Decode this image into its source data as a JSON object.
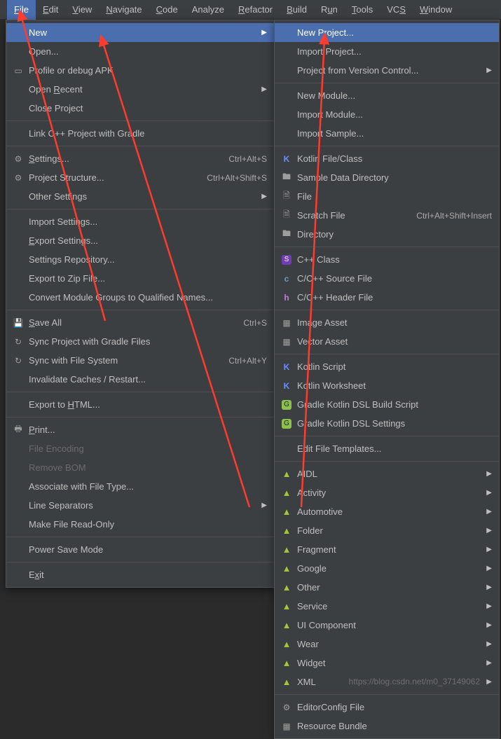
{
  "menubar": {
    "items": [
      {
        "label": "File",
        "mnemonic": "F",
        "active": true
      },
      {
        "label": "Edit",
        "mnemonic": "E"
      },
      {
        "label": "View",
        "mnemonic": "V"
      },
      {
        "label": "Navigate",
        "mnemonic": "N"
      },
      {
        "label": "Code",
        "mnemonic": "C"
      },
      {
        "label": "Analyze"
      },
      {
        "label": "Refactor",
        "mnemonic": "R"
      },
      {
        "label": "Build",
        "mnemonic": "B"
      },
      {
        "label": "Run",
        "mnemonic": "u"
      },
      {
        "label": "Tools",
        "mnemonic": "T"
      },
      {
        "label": "VCS",
        "mnemonic": "S"
      },
      {
        "label": "Window",
        "mnemonic": "W"
      }
    ]
  },
  "fileMenu": {
    "groups": [
      [
        {
          "label": "New",
          "submenu": true,
          "highlight": true
        },
        {
          "label": "Open..."
        },
        {
          "label": "Profile or debug APK",
          "icon": "pkg"
        },
        {
          "label": "Open Recent",
          "submenu": true,
          "mnemonic": "R"
        },
        {
          "label": "Close Project"
        }
      ],
      [
        {
          "label": "Link C++ Project with Gradle"
        }
      ],
      [
        {
          "label": "Settings...",
          "icon": "gear",
          "mnemonic": "S",
          "shortcut": "Ctrl+Alt+S"
        },
        {
          "label": "Project Structure...",
          "icon": "gear",
          "shortcut": "Ctrl+Alt+Shift+S"
        },
        {
          "label": "Other Settings",
          "submenu": true
        }
      ],
      [
        {
          "label": "Import Settings..."
        },
        {
          "label": "Export Settings...",
          "mnemonic": "E"
        },
        {
          "label": "Settings Repository..."
        },
        {
          "label": "Export to Zip File..."
        },
        {
          "label": "Convert Module Groups to Qualified Names..."
        }
      ],
      [
        {
          "label": "Save All",
          "icon": "save",
          "mnemonic": "S",
          "shortcut": "Ctrl+S"
        },
        {
          "label": "Sync Project with Gradle Files",
          "icon": "sync"
        },
        {
          "label": "Sync with File System",
          "icon": "sync",
          "shortcut": "Ctrl+Alt+Y"
        },
        {
          "label": "Invalidate Caches / Restart..."
        }
      ],
      [
        {
          "label": "Export to HTML...",
          "mnemonic": "H"
        }
      ],
      [
        {
          "label": "Print...",
          "icon": "print",
          "mnemonic": "P"
        },
        {
          "label": "File Encoding",
          "disabled": true
        },
        {
          "label": "Remove BOM",
          "disabled": true
        },
        {
          "label": "Associate with File Type..."
        },
        {
          "label": "Line Separators",
          "submenu": true
        },
        {
          "label": "Make File Read-Only"
        }
      ],
      [
        {
          "label": "Power Save Mode"
        }
      ],
      [
        {
          "label": "Exit",
          "mnemonic": "x"
        }
      ]
    ]
  },
  "newMenu": {
    "groups": [
      [
        {
          "label": "New Project...",
          "highlight": true
        },
        {
          "label": "Import Project..."
        },
        {
          "label": "Project from Version Control...",
          "submenu": true
        }
      ],
      [
        {
          "label": "New Module..."
        },
        {
          "label": "Import Module..."
        },
        {
          "label": "Import Sample..."
        }
      ],
      [
        {
          "label": "Kotlin File/Class",
          "icon": "kotlin"
        },
        {
          "label": "Sample Data Directory",
          "icon": "folder"
        },
        {
          "label": "File",
          "icon": "file"
        },
        {
          "label": "Scratch File",
          "icon": "scratch",
          "shortcut": "Ctrl+Alt+Shift+Insert"
        },
        {
          "label": "Directory",
          "icon": "folder"
        }
      ],
      [
        {
          "label": "C++ Class",
          "icon": "cpp"
        },
        {
          "label": "C/C++ Source File",
          "icon": "c"
        },
        {
          "label": "C/C++ Header File",
          "icon": "h"
        }
      ],
      [
        {
          "label": "Image Asset",
          "icon": "image"
        },
        {
          "label": "Vector Asset",
          "icon": "image"
        }
      ],
      [
        {
          "label": "Kotlin Script",
          "icon": "kotlin"
        },
        {
          "label": "Kotlin Worksheet",
          "icon": "kotlin"
        },
        {
          "label": "Gradle Kotlin DSL Build Script",
          "icon": "gradle"
        },
        {
          "label": "Gradle Kotlin DSL Settings",
          "icon": "gradle"
        }
      ],
      [
        {
          "label": "Edit File Templates..."
        }
      ],
      [
        {
          "label": "AIDL",
          "icon": "android",
          "submenu": true
        },
        {
          "label": "Activity",
          "icon": "android",
          "submenu": true
        },
        {
          "label": "Automotive",
          "icon": "android",
          "submenu": true
        },
        {
          "label": "Folder",
          "icon": "android",
          "submenu": true
        },
        {
          "label": "Fragment",
          "icon": "android",
          "submenu": true
        },
        {
          "label": "Google",
          "icon": "android",
          "submenu": true
        },
        {
          "label": "Other",
          "icon": "android",
          "submenu": true
        },
        {
          "label": "Service",
          "icon": "android",
          "submenu": true
        },
        {
          "label": "UI Component",
          "icon": "android",
          "submenu": true
        },
        {
          "label": "Wear",
          "icon": "android",
          "submenu": true
        },
        {
          "label": "Widget",
          "icon": "android",
          "submenu": true
        },
        {
          "label": "XML",
          "icon": "android",
          "submenu": true
        }
      ],
      [
        {
          "label": "EditorConfig File",
          "icon": "editorconfig"
        },
        {
          "label": "Resource Bundle",
          "icon": "image"
        }
      ]
    ]
  },
  "watermark": "https://blog.csdn.net/m0_37149062"
}
